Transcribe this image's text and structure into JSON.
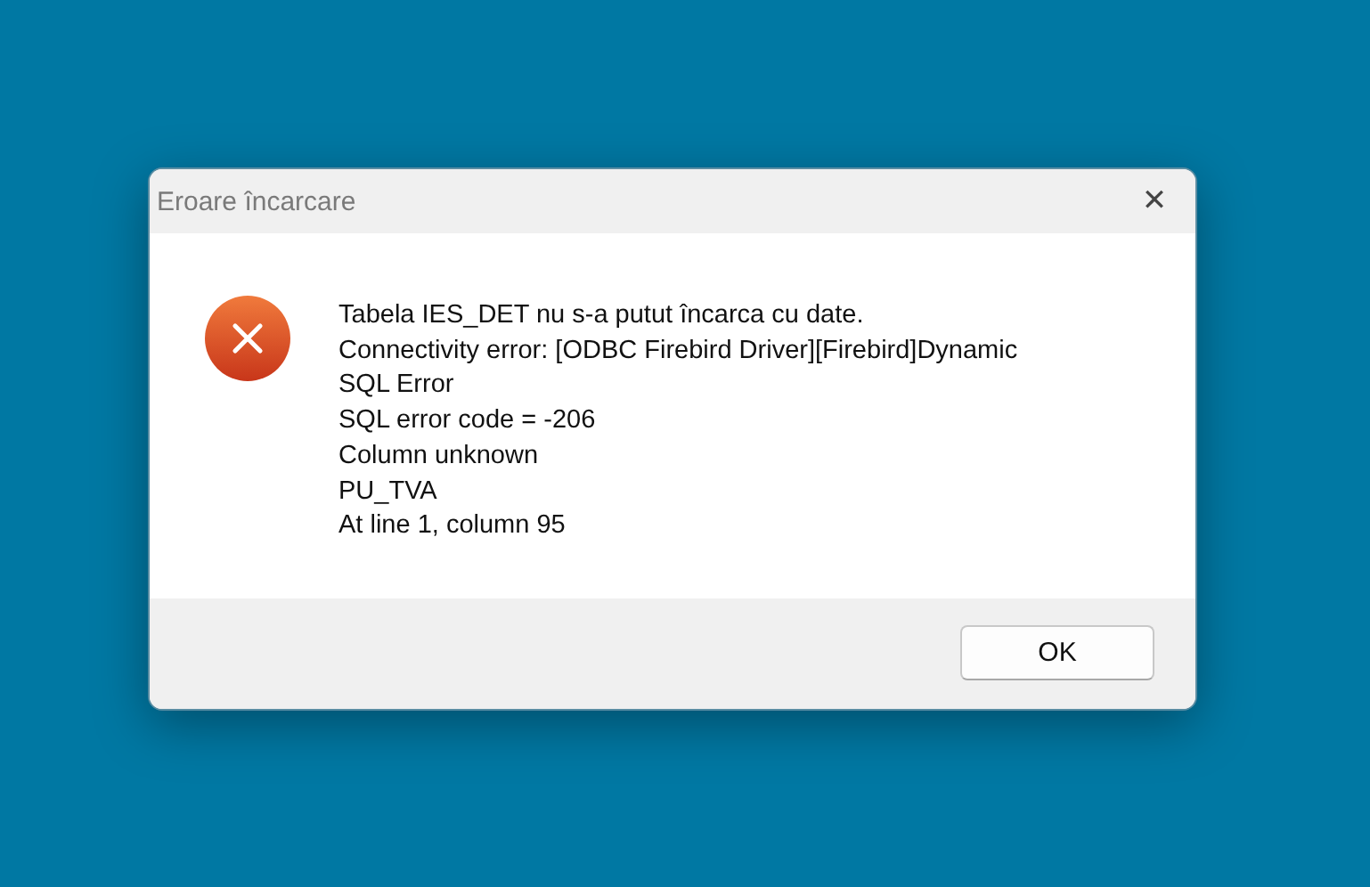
{
  "window": {
    "title": "Eroare încarcare",
    "close": "✕"
  },
  "message": {
    "kind": "error",
    "lines": [
      "Tabela IES_DET nu s-a putut încarca cu date.",
      "Connectivity error: [ODBC Firebird Driver][Firebird]Dynamic",
      "SQL Error",
      "SQL error code = -206",
      "Column unknown",
      "PU_TVA",
      "At line 1, column 95"
    ]
  },
  "buttons": [
    {
      "label": "OK",
      "selected": true
    }
  ]
}
